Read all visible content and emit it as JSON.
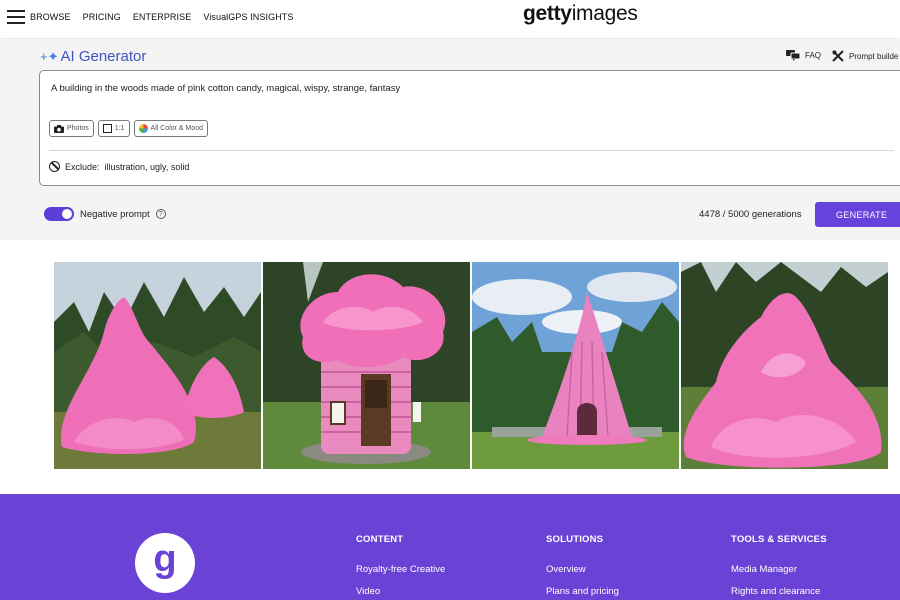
{
  "nav": {
    "links": [
      "BROWSE",
      "PRICING",
      "ENTERPRISE",
      "VisualGPS INSIGHTS"
    ],
    "logo_bold": "getty",
    "logo_light": "images"
  },
  "generator": {
    "title": "AI Generator",
    "faq": "FAQ",
    "prompt_builder": "Prompt builde",
    "prompt": "A building in the woods made of pink cotton candy, magical, wispy, strange, fantasy",
    "chips": {
      "photos": "Photos",
      "ratio": "1:1",
      "color": "All Color & Mood"
    },
    "exclude_label": "Exclude:",
    "exclude_value": "illustration, ugly, solid",
    "negative_prompt": "Negative prompt",
    "negative_prompt_on": true,
    "generations": "4478 / 5000 generations",
    "generate": "GENERATE"
  },
  "colors": {
    "accent": "#6543dc",
    "footer": "#6a43d6",
    "title": "#3d55c4"
  },
  "footer": {
    "logo_letter": "g",
    "content": {
      "heading": "CONTENT",
      "links": [
        "Royalty-free Creative",
        "Video"
      ]
    },
    "solutions": {
      "heading": "SOLUTIONS",
      "links": [
        "Overview",
        "Plans and pricing"
      ]
    },
    "tools": {
      "heading": "TOOLS & SERVICES",
      "links": [
        "Media Manager",
        "Rights and clearance"
      ]
    }
  }
}
